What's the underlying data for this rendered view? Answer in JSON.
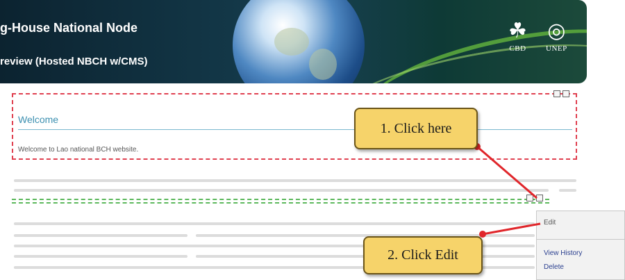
{
  "header": {
    "title_line1": "g-House National Node",
    "title_line2": "review (Hosted NBCH w/CMS)",
    "logos": [
      {
        "label": "CBD",
        "icon": "cbd-logo-icon"
      },
      {
        "label": "UNEP",
        "icon": "unep-logo-icon"
      }
    ]
  },
  "welcome_part": {
    "title": "Welcome",
    "text": "Welcome to Lao national BCH website."
  },
  "context_menu": {
    "items": [
      "Edit",
      "View History",
      "Delete"
    ]
  },
  "callouts": {
    "step1": "1. Click here",
    "step2": "2. Click Edit"
  },
  "colors": {
    "callout_fill": "#f6d36a",
    "arrow": "#e0262b",
    "selected_part_border": "#e04050",
    "other_part_border": "#5cb85c",
    "welcome_title": "#3b8fb0"
  }
}
